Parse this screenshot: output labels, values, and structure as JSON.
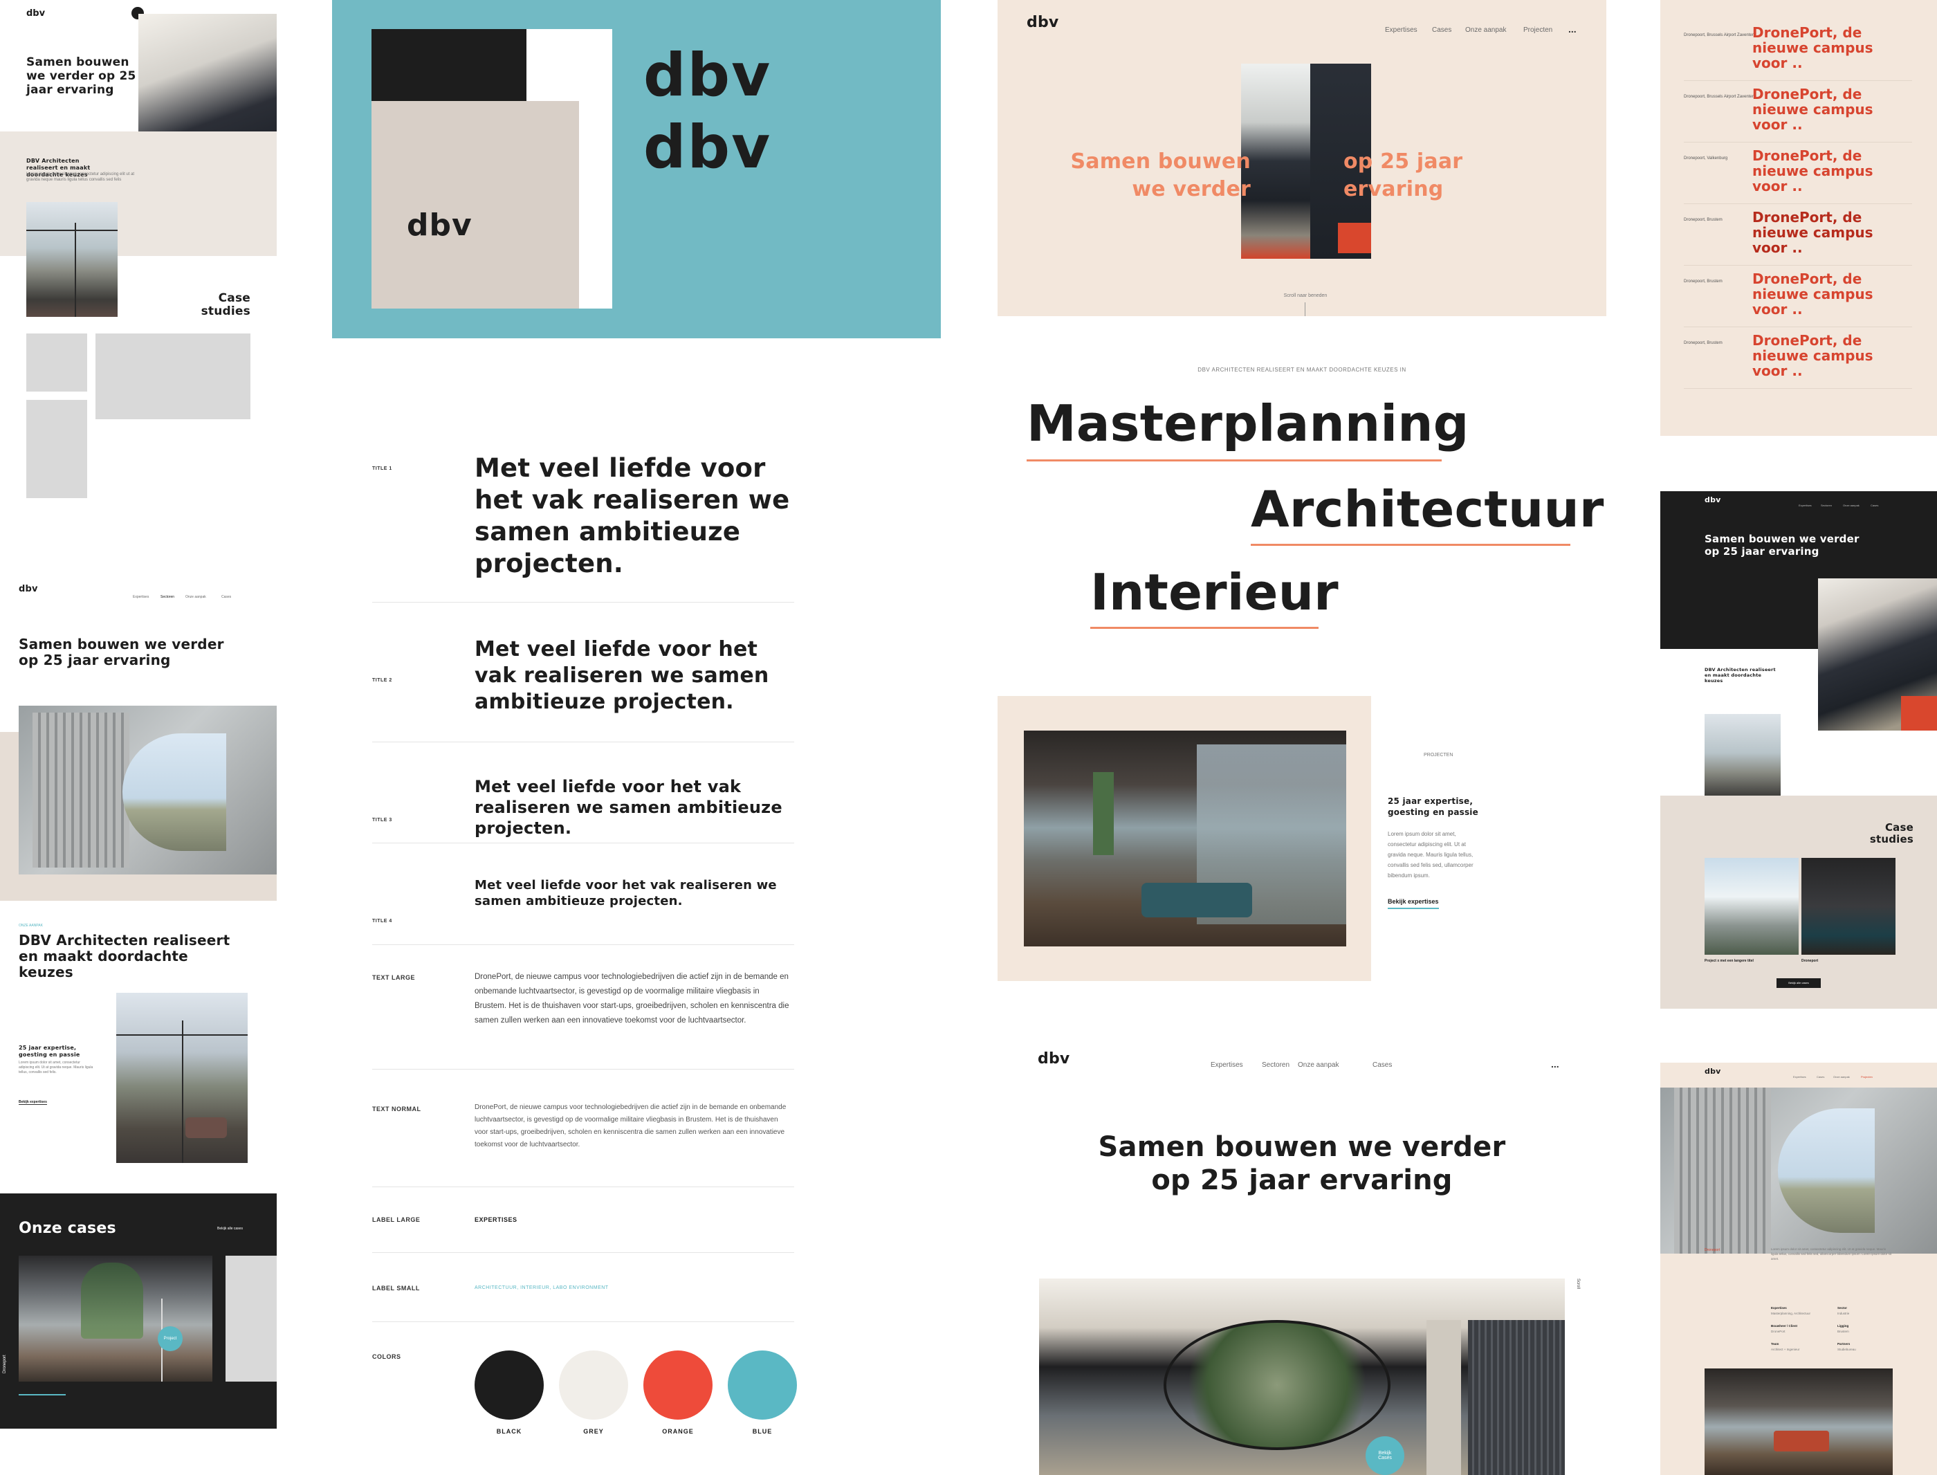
{
  "logo": "dbv",
  "colors": {
    "black": "#1d1d1d",
    "grey": "#f1eee9",
    "orange": "#ee4b3a",
    "blue": "#5ab8c4",
    "teal_bg": "#72bac4",
    "beige": "#f3e7dc",
    "sand": "#e6ddd5",
    "accent": "#f08a65",
    "red_text": "#d7442f"
  },
  "mobile_top": {
    "hero_title": "Samen bouwen we verder op 25 jaar ervaring",
    "intro_title": "DBV Architecten realiseert en maakt doordachte keuzes",
    "intro_body": "Lorem ipsum dolor sit amet consectetur adipiscing elit ut at gravida neque mauris ligula tellus convallis sed felis",
    "case_studies": "Case studies"
  },
  "logo_board": {
    "wordmark_1": "dbv",
    "wordmark_2": "dbv",
    "card_logo": "dbv"
  },
  "desktop_hero": {
    "nav": [
      "Expertises",
      "Cases",
      "Onze aanpak",
      "Projecten"
    ],
    "more_icon": "...",
    "title_left": "Samen bouwen we verder",
    "title_right": "op 25 jaar ervaring",
    "scroll_label": "Scroll naar beneden"
  },
  "campus_list": {
    "items": [
      {
        "meta": "Dronepoort, Brussels Airport Zaventem",
        "title": "DronePort, de nieuwe campus voor .."
      },
      {
        "meta": "Dronepoort, Brussels Airport Zaventem",
        "title": "DronePort, de nieuwe campus voor .."
      },
      {
        "meta": "Dronepoort, Valkenburg",
        "title": "DronePort, de nieuwe campus voor .."
      },
      {
        "meta": "Dronepoort, Brustem",
        "title": "DronePort, de nieuwe campus voor .."
      },
      {
        "meta": "Dronepoort, Brustem",
        "title": "DronePort, de nieuwe campus voor .."
      },
      {
        "meta": "Dronepoort, Brustem",
        "title": "DronePort, de nieuwe campus voor .."
      }
    ]
  },
  "mobile_mid": {
    "nav": [
      "Expertises",
      "Sectoren",
      "Onze aanpak",
      "Cases"
    ],
    "hero_title": "Samen bouwen we verder op 25 jaar ervaring",
    "kicker": "ONZE AANPAK",
    "intro_title": "DBV Architecten realiseert en maakt doordachte keuzes",
    "side_title": "25 jaar expertise, goesting en passie",
    "side_body": "Lorem ipsum dolor sit amet, consectetur adipiscing elit. Ut at gravida neque. Mauris ligula tellus, convallis sed felis.",
    "side_link": "Bekijk expertises"
  },
  "mobile_cases": {
    "title": "Onze cases",
    "link": "Bekijk alle cases",
    "badge": "Project",
    "side_label": "Droneport"
  },
  "typography": {
    "rows": [
      {
        "label": "TITLE 1",
        "sample": "Met veel liefde voor het vak realiseren we samen ambitieuze projecten."
      },
      {
        "label": "TITLE 2",
        "sample": "Met veel liefde voor het vak realiseren we samen ambitieuze projecten."
      },
      {
        "label": "TITLE 3",
        "sample": "Met veel liefde voor het vak realiseren we samen ambitieuze projecten."
      },
      {
        "label": "TITLE 4",
        "sample": "Met veel liefde voor het vak realiseren we samen ambitieuze projecten."
      }
    ],
    "text_large_label": "TEXT LARGE",
    "text_large": "DronePort, de nieuwe campus voor technologiebedrijven die actief zijn in de bemande en onbemande luchtvaartsector, is gevestigd op de voormalige militaire vliegbasis in Brustem. Het is de thuishaven voor start-ups, groeibedrijven, scholen en kenniscentra die samen zullen werken aan een innovatieve toekomst voor de luchtvaartsector.",
    "text_normal_label": "TEXT NORMAL",
    "text_normal": "DronePort, de nieuwe campus voor technologiebedrijven die actief zijn in de bemande en onbemande luchtvaartsector, is gevestigd op de voormalige militaire vliegbasis in Brustem. Het is de thuishaven voor start-ups, groeibedrijven, scholen en kenniscentra die samen zullen werken aan een innovatieve toekomst voor de luchtvaartsector.",
    "label_large_label": "LABEL LARGE",
    "label_large": "EXPERTISES",
    "label_small_label": "LABEL SMALL",
    "label_small": "ARCHITECTUUR, INTERIEUR, LABO ENVIRONMENT",
    "colors_label": "COLORS",
    "swatches": [
      {
        "name": "BLACK",
        "hex": "#1d1d1d"
      },
      {
        "name": "GREY",
        "hex": "#f1eee9"
      },
      {
        "name": "ORANGE",
        "hex": "#ee4b3a"
      },
      {
        "name": "BLUE",
        "hex": "#5ab8c4"
      }
    ]
  },
  "expertises": {
    "kicker": "DBV ARCHITECTEN REALISEERT EN MAAKT DOORDACHTE KEUZES IN",
    "items": [
      "Masterplanning",
      "Architectuur",
      "Interieur"
    ]
  },
  "project_block": {
    "kicker": "PROJECTEN",
    "title": "25 jaar expertise, goesting en passie",
    "body": "Lorem ipsum dolor sit amet, consectetur adipiscing elit. Ut at gravida neque. Mauris ligula tellus, convallis sed felis sed, ullamcorper bibendum ipsum.",
    "link": "Bekijk expertises"
  },
  "desktop_bottom": {
    "nav": [
      "Expertises",
      "Sectoren",
      "Onze aanpak",
      "Cases"
    ],
    "title": "Samen bouwen we verder op 25 jaar ervaring",
    "scroll": "Scroll",
    "badge": "Bekijk Cases"
  },
  "mobile_dark": {
    "nav": [
      "Expertises",
      "Sectoren",
      "Onze aanpak",
      "Cases"
    ],
    "hero_title": "Samen bouwen we verder op 25 jaar ervaring",
    "intro_title": "DBV Architecten realiseert en maakt doordachte keuzes",
    "case_studies": "Case studies",
    "case_1": "Project x met een langere titel",
    "case_2": "Droneport",
    "button": "Bekijk alle cases"
  },
  "mobile_detail": {
    "nav": [
      "Expertises",
      "Cases",
      "Onze aanpak",
      "Projecten"
    ],
    "kicker": "Droneport",
    "body": "Lorem ipsum dolor sit amet, consectetur adipiscing elit. Ut at gravida neque. Mauris ligula tellus, convallis sed felis sed, ullamcorper bibendum ipsum. Lorem ipsum dolor sit amet.",
    "facts": [
      {
        "k": "Expertises",
        "v": "Masterplanning, Architectuur"
      },
      {
        "k": "Sector",
        "v": "Industrie"
      },
      {
        "k": "Bouwheer / Client",
        "v": "DronePort"
      },
      {
        "k": "Ligging",
        "v": "Brustem"
      },
      {
        "k": "Team",
        "v": "Architect + Ingenieur"
      },
      {
        "k": "Partners",
        "v": "Studiebureau"
      }
    ]
  }
}
